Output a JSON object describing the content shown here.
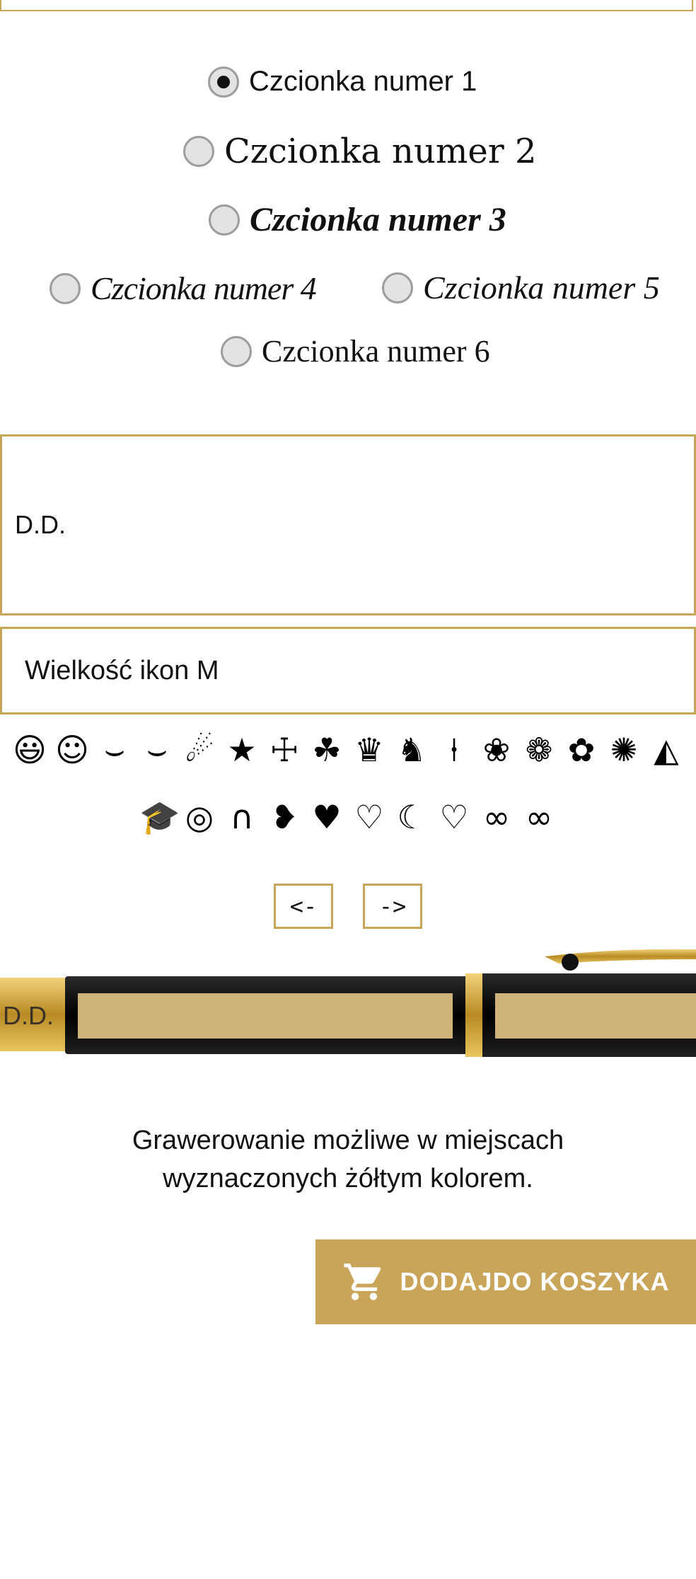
{
  "font_options": [
    {
      "label": "Czcionka numer 1",
      "checked": true
    },
    {
      "label": "Czcionka numer 2",
      "checked": false
    },
    {
      "label": "Czcionka numer 3",
      "checked": false
    },
    {
      "label": "Czcionka numer 4",
      "checked": false
    },
    {
      "label": "Czcionka numer 5",
      "checked": false
    },
    {
      "label": "Czcionka numer 6",
      "checked": false
    }
  ],
  "engraving_text": "D.D.",
  "icon_size": {
    "selected": "Wielkość ikon M"
  },
  "icons_row1": [
    "😃",
    "☺",
    "⌣",
    "⌣",
    "☄",
    "★",
    "☩",
    "☘",
    "♛",
    "♞",
    "⍿",
    "❀",
    "❁",
    "✿",
    "✺",
    "◭"
  ],
  "icons_row1_names": [
    "big-smile-icon",
    "smile-icon",
    "smile-drop-icon",
    "grin-icon",
    "shooting-star-icon",
    "star-icon",
    "ihs-icon",
    "clover-icon",
    "crown-icon",
    "cat-icon",
    "tie-icon",
    "rose-icon",
    "rose-bud-icon",
    "paw-icon",
    "badge-icon",
    "grad-cap-icon"
  ],
  "icons_row2": [
    "🎓",
    "◎",
    "∩",
    "❥",
    "♥",
    "♡",
    "☾",
    "♡",
    "∞",
    "∞"
  ],
  "icons_row2_names": [
    "graduation-icon",
    "rings-icon",
    "horseshoe-icon",
    "heart-tilt-icon",
    "heart-icon",
    "heart-outline-icon",
    "heart-open-icon",
    "double-heart-icon",
    "infinity-icon",
    "infinity-outline-icon"
  ],
  "nav": {
    "prev": "<-",
    "next": "->"
  },
  "pen_preview_text": "D.D.",
  "info_text": "Grawerowanie możliwe w miejscach wyznaczonych żółtym kolorem.",
  "cart_button": "DODAJDO KOSZYKA",
  "colors": {
    "accent": "#c9a55a",
    "pen_body": "#0a0a0a",
    "gold": "#d4a93a"
  }
}
